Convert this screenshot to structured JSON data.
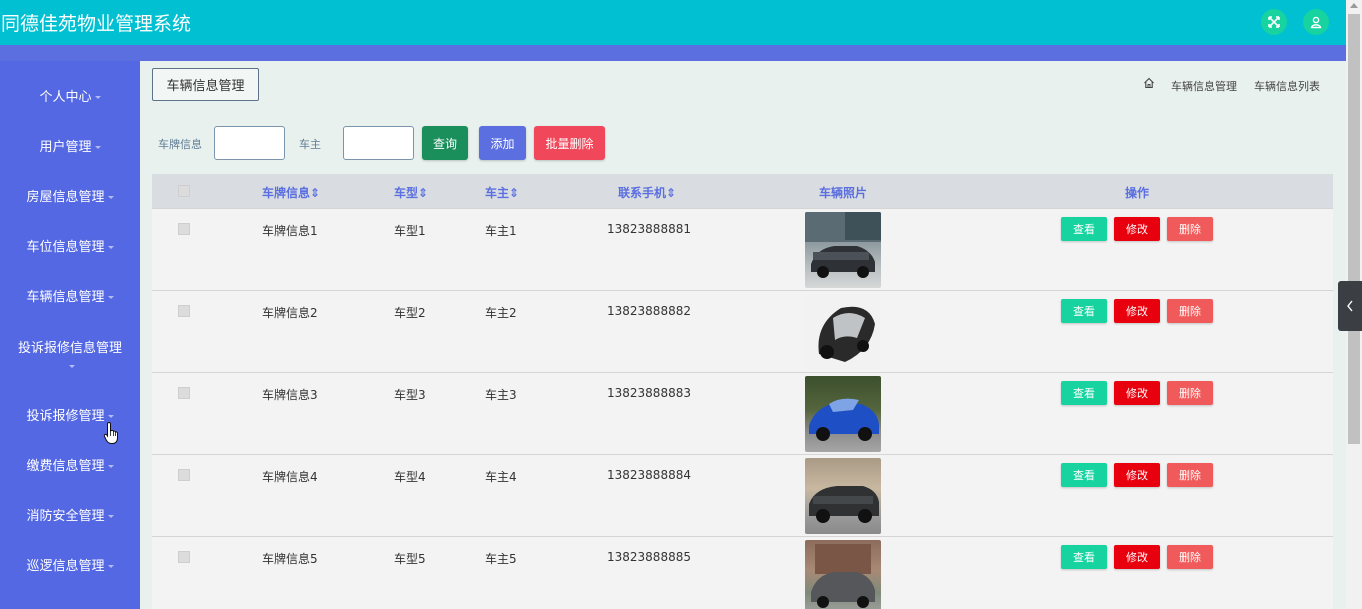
{
  "header": {
    "title": "同德佳苑物业管理系统",
    "fullscreen_icon": "fullscreen-icon",
    "user_icon": "user-icon"
  },
  "sidebar": {
    "items": [
      {
        "label": "个人中心"
      },
      {
        "label": "用户管理"
      },
      {
        "label": "房屋信息管理"
      },
      {
        "label": "车位信息管理"
      },
      {
        "label": "车辆信息管理"
      },
      {
        "label": "投诉报修信息管理"
      },
      {
        "label": "投诉报修管理"
      },
      {
        "label": "缴费信息管理"
      },
      {
        "label": "消防安全管理"
      },
      {
        "label": "巡逻信息管理"
      }
    ]
  },
  "main": {
    "page_button": "车辆信息管理",
    "breadcrumb": [
      "车辆信息管理",
      "车辆信息列表"
    ],
    "search": {
      "plate_label": "车牌信息",
      "plate_value": "",
      "owner_label": "车主",
      "owner_value": "",
      "query_label": "查询",
      "add_label": "添加",
      "batch_delete_label": "批量删除"
    },
    "columns": [
      "车牌信息",
      "车型",
      "车主",
      "联系手机",
      "车辆照片",
      "操作"
    ],
    "sort_marker": "⇕",
    "actions": {
      "view": "查看",
      "edit": "修改",
      "delete": "删除"
    },
    "rows": [
      {
        "plate": "车牌信息1",
        "model": "车型1",
        "owner": "车主1",
        "phone": "13823888881"
      },
      {
        "plate": "车牌信息2",
        "model": "车型2",
        "owner": "车主2",
        "phone": "13823888882"
      },
      {
        "plate": "车牌信息3",
        "model": "车型3",
        "owner": "车主3",
        "phone": "13823888883"
      },
      {
        "plate": "车牌信息4",
        "model": "车型4",
        "owner": "车主4",
        "phone": "13823888884"
      },
      {
        "plate": "车牌信息5",
        "model": "车型5",
        "owner": "车主5",
        "phone": "13823888885"
      }
    ]
  },
  "colors": {
    "header": "#00c0d1",
    "sidebar": "#5468e3",
    "query_button": "#1a8f5c",
    "add_button": "#5b6fe0",
    "batch_delete_button": "#f0475a",
    "view_button": "#16d3a0",
    "edit_button": "#e8000e",
    "delete_button": "#f05a5a"
  }
}
